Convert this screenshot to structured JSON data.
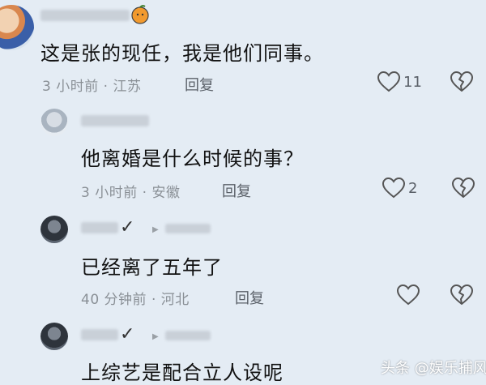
{
  "comments": [
    {
      "text": "这是张的现任，我是他们同事。",
      "time": "3 小时前",
      "location": "江苏",
      "reply": "回复",
      "likes": "11"
    },
    {
      "text": "他离婚是什么时候的事？",
      "time": "3 小时前",
      "location": "安徽",
      "reply": "回复",
      "likes": "2"
    },
    {
      "text": "已经离了五年了",
      "time": "40 分钟前",
      "location": "河北",
      "reply": "回复",
      "likes": ""
    },
    {
      "text": "上综艺是配合立人设呢"
    }
  ],
  "separator": "·",
  "watermark": "头条 @娱乐捕风"
}
